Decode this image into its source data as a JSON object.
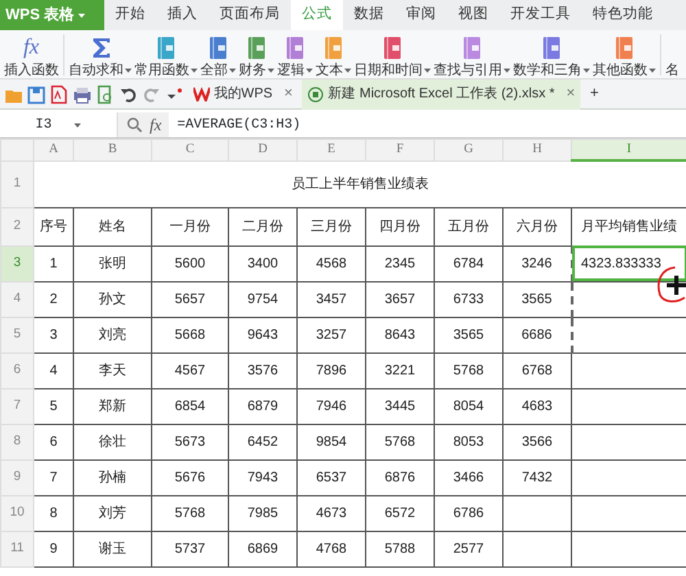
{
  "app": {
    "logo": "WPS 表格"
  },
  "menu_tabs": [
    {
      "label": "开始",
      "selected": false
    },
    {
      "label": "插入",
      "selected": false
    },
    {
      "label": "页面布局",
      "selected": false
    },
    {
      "label": "公式",
      "selected": true
    },
    {
      "label": "数据",
      "selected": false
    },
    {
      "label": "审阅",
      "selected": false
    },
    {
      "label": "视图",
      "selected": false
    },
    {
      "label": "开发工具",
      "selected": false
    },
    {
      "label": "特色功能",
      "selected": false
    }
  ],
  "ribbon": [
    {
      "label": "插入函数",
      "kind": "big",
      "icon_text": "fx"
    },
    {
      "label": "自动求和",
      "kind": "sum"
    },
    {
      "label": "常用函数",
      "kind": "book",
      "color": "#3aa6c8"
    },
    {
      "label": "全部",
      "kind": "book",
      "color": "#4a7fd0"
    },
    {
      "label": "财务",
      "kind": "book",
      "color": "#5aa05a"
    },
    {
      "label": "逻辑",
      "kind": "book",
      "color": "#b27fd6"
    },
    {
      "label": "文本",
      "kind": "book",
      "color": "#f0a040"
    },
    {
      "label": "日期和时间",
      "kind": "book",
      "color": "#e0506a"
    },
    {
      "label": "查找与引用",
      "kind": "book",
      "color": "#b98ae0"
    },
    {
      "label": "数学和三角",
      "kind": "book",
      "color": "#7a7ae0"
    },
    {
      "label": "其他函数",
      "kind": "book",
      "color": "#f08050"
    },
    {
      "label": "名",
      "kind": "text"
    }
  ],
  "doc_tabs": [
    {
      "label": "我的WPS",
      "kind": "home",
      "selected": false,
      "close": "×"
    },
    {
      "label": "新建 Microsoft Excel 工作表 (2).xlsx *",
      "kind": "sheet",
      "selected": true,
      "close": "×"
    }
  ],
  "new_tab": "+",
  "formula_bar": {
    "cell_ref": "I3",
    "fx": "fx",
    "formula": "=AVERAGE(C3:H3)"
  },
  "sheet": {
    "columns": [
      {
        "label": "A",
        "selected": false
      },
      {
        "label": "B",
        "selected": false
      },
      {
        "label": "C",
        "selected": false
      },
      {
        "label": "D",
        "selected": false
      },
      {
        "label": "E",
        "selected": false
      },
      {
        "label": "F",
        "selected": false
      },
      {
        "label": "G",
        "selected": false
      },
      {
        "label": "H",
        "selected": false
      },
      {
        "label": "I",
        "selected": true
      }
    ],
    "title_row": {
      "number": "1",
      "title": "员工上半年销售业绩表"
    },
    "rows": [
      {
        "number": "2",
        "kind": "header",
        "selected": false,
        "marquee": false,
        "cells": [
          "序号",
          "姓名",
          "一月份",
          "二月份",
          "三月份",
          "四月份",
          "五月份",
          "六月份",
          "月平均销售业绩"
        ]
      },
      {
        "number": "3",
        "kind": "data",
        "selected": true,
        "marquee": true,
        "cells": [
          "1",
          "张明",
          "5600",
          "3400",
          "4568",
          "2345",
          "6784",
          "3246",
          "4323.833333"
        ]
      },
      {
        "number": "4",
        "kind": "data",
        "selected": false,
        "marquee": true,
        "cells": [
          "2",
          "孙文",
          "5657",
          "9754",
          "3457",
          "3657",
          "6733",
          "3565"
        ]
      },
      {
        "number": "5",
        "kind": "data",
        "selected": false,
        "marquee": true,
        "cells": [
          "3",
          "刘亮",
          "5668",
          "9643",
          "3257",
          "8643",
          "3565",
          "6686"
        ]
      },
      {
        "number": "6",
        "kind": "data",
        "selected": false,
        "marquee": false,
        "cells": [
          "4",
          "李天",
          "4567",
          "3576",
          "7896",
          "3221",
          "5768",
          "6768"
        ]
      },
      {
        "number": "7",
        "kind": "data",
        "selected": false,
        "marquee": false,
        "cells": [
          "5",
          "郑新",
          "6854",
          "6879",
          "7946",
          "3445",
          "8054",
          "4683"
        ]
      },
      {
        "number": "8",
        "kind": "data",
        "selected": false,
        "marquee": false,
        "cells": [
          "6",
          "徐壮",
          "5673",
          "6452",
          "9854",
          "5768",
          "8053",
          "3566"
        ]
      },
      {
        "number": "9",
        "kind": "data",
        "selected": false,
        "marquee": false,
        "cells": [
          "7",
          "孙楠",
          "5676",
          "7943",
          "6537",
          "6876",
          "3466",
          "7432"
        ]
      },
      {
        "number": "10",
        "kind": "data",
        "selected": false,
        "marquee": false,
        "cells": [
          "8",
          "刘芳",
          "5768",
          "7985",
          "4673",
          "6572",
          "6786"
        ]
      },
      {
        "number": "11",
        "kind": "data",
        "selected": false,
        "marquee": false,
        "cells": [
          "9",
          "谢玉",
          "5737",
          "6869",
          "4768",
          "5788",
          "2577"
        ]
      }
    ]
  },
  "annotation": {
    "kind": "circle"
  }
}
